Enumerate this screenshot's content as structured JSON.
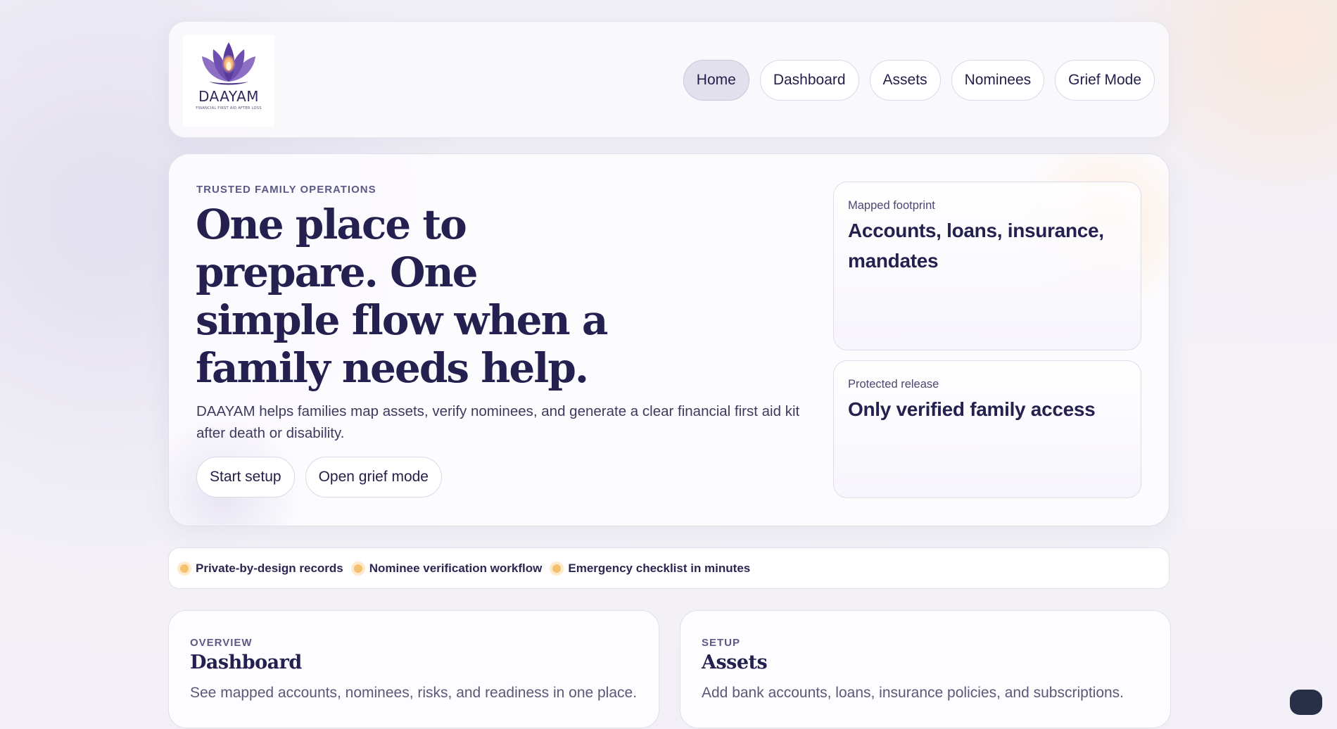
{
  "logo": {
    "name": "DAAYAM",
    "tagline": "FINANCIAL FIRST AID AFTER LOSS"
  },
  "nav": {
    "items": [
      {
        "label": "Home",
        "active": true
      },
      {
        "label": "Dashboard",
        "active": false
      },
      {
        "label": "Assets",
        "active": false
      },
      {
        "label": "Nominees",
        "active": false
      },
      {
        "label": "Grief Mode",
        "active": false
      }
    ]
  },
  "hero": {
    "eyebrow": "TRUSTED FAMILY OPERATIONS",
    "headline": "One place to prepare. One simple flow when a family needs help.",
    "subtitle": "DAAYAM helps families map assets, verify nominees, and generate a clear financial first aid kit after death or disability.",
    "buttons": {
      "primary": "Start setup",
      "secondary": "Open grief mode"
    },
    "cards": [
      {
        "label": "Mapped footprint",
        "title": "Accounts, loans, insurance, mandates"
      },
      {
        "label": "Protected release",
        "title": "Only verified family access"
      }
    ]
  },
  "highlights": [
    "Private-by-design records",
    "Nominee verification workflow",
    "Emergency checklist in minutes"
  ],
  "features": [
    {
      "eyebrow": "OVERVIEW",
      "title": "Dashboard",
      "description": "See mapped accounts, nominees, risks, and readiness in one place."
    },
    {
      "eyebrow": "SETUP",
      "title": "Assets",
      "description": "Add bank accounts, loans, insurance policies, and subscriptions."
    }
  ],
  "colors": {
    "ink": "#24204f",
    "accent_dot": "#f6c06e",
    "nav_active_bg": "#e3e0ee",
    "chat_button": "#273047"
  }
}
